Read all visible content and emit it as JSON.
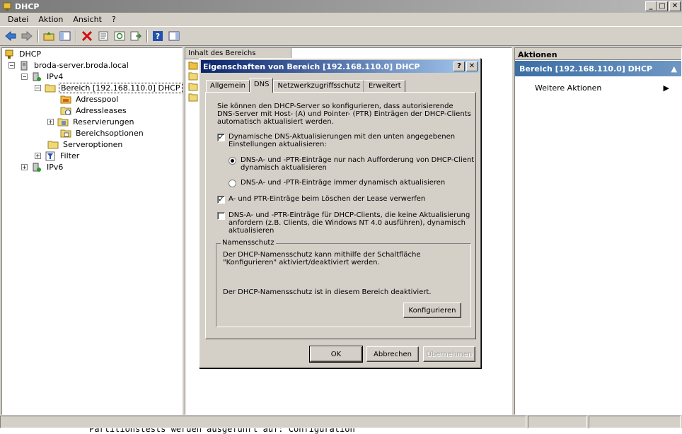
{
  "window": {
    "title": "DHCP"
  },
  "menu": [
    "Datei",
    "Aktion",
    "Ansicht",
    "?"
  ],
  "tree": {
    "root": "DHCP",
    "server": "broda-server.broda.local",
    "ipv4": "IPv4",
    "scope": "Bereich [192.168.110.0] DHCP",
    "address_pool": "Adresspool",
    "address_leases": "Adressleases",
    "reservations": "Reservierungen",
    "scope_options": "Bereichsoptionen",
    "server_options": "Serveroptionen",
    "filter": "Filter",
    "ipv6": "IPv6"
  },
  "content": {
    "header": "Inhalt des Bereichs"
  },
  "actions": {
    "header": "Aktionen",
    "scope": "Bereich [192.168.110.0] DHCP",
    "more": "Weitere Aktionen"
  },
  "dialog": {
    "title": "Eigenschaften von Bereich [192.168.110.0] DHCP",
    "tabs": [
      "Allgemein",
      "DNS",
      "Netzwerkzugriffsschutz",
      "Erweitert"
    ],
    "intro": [
      "Sie können den DHCP-Server so konfigurieren, dass autorisierende",
      "DNS-Server mit Host- (A) und Pointer- (PTR) Einträgen der DHCP-Clients",
      "automatisch aktualisiert werden."
    ],
    "chk_dynamic": [
      "Dynamische DNS-Aktualisierungen mit den unten angegebenen",
      "Einstellungen aktualisieren:"
    ],
    "radio_request": [
      "DNS-A- und -PTR-Einträge nur nach Aufforderung von DHCP-Client",
      "dynamisch aktualisieren"
    ],
    "radio_always": "DNS-A- und -PTR-Einträge immer dynamisch aktualisieren",
    "chk_delete": "A- und PTR-Einträge beim Löschen der Lease verwerfen",
    "chk_no_update": [
      "DNS-A- und -PTR-Einträge für DHCP-Clients, die keine Aktualisierung",
      "anfordern (z.B. Clients, die Windows NT 4.0 ausführen), dynamisch",
      "aktualisieren"
    ],
    "group_title": "Namensschutz",
    "group_text": [
      "Der DHCP-Namensschutz kann mithilfe der Schaltfläche",
      "\"Konfigurieren\" aktiviert/deaktiviert werden."
    ],
    "group_status": "Der DHCP-Namensschutz ist in diesem Bereich deaktiviert.",
    "configure_btn": "Konfigurieren",
    "ok_btn": "OK",
    "cancel_btn": "Abbrechen",
    "apply_btn": "Übernehmen"
  },
  "console_text": "Partitionstests werden ausgeführt auf: Configuration"
}
